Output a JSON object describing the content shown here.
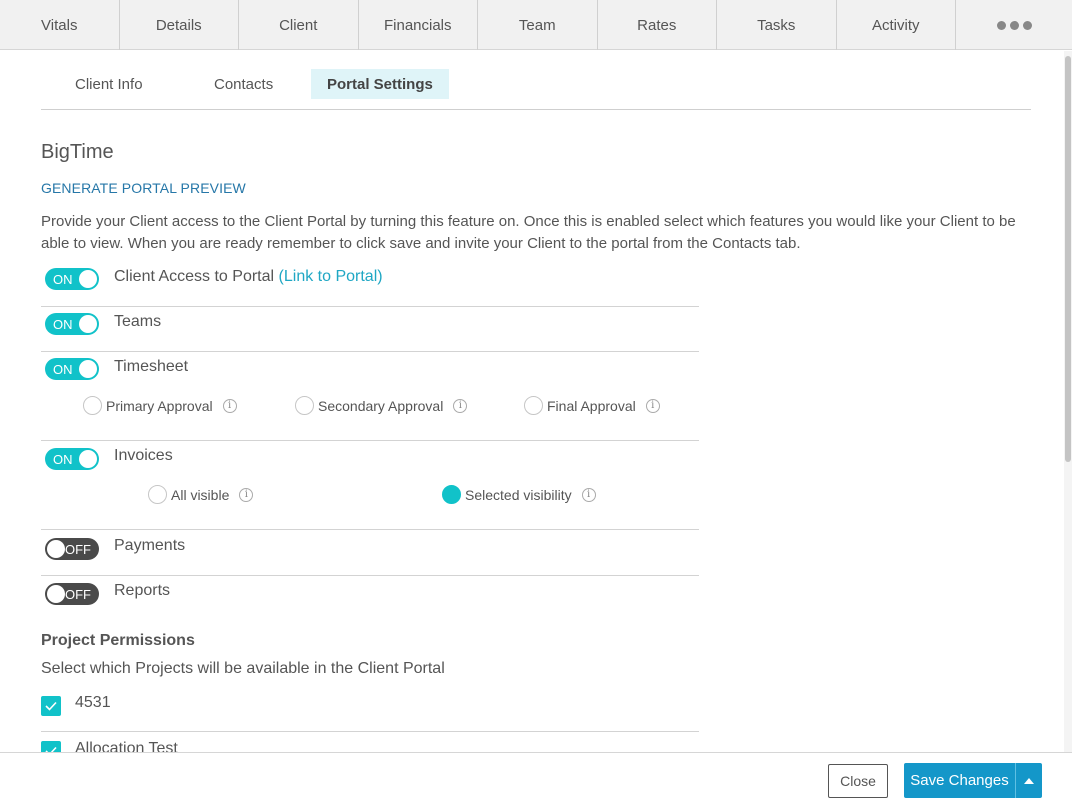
{
  "top_tabs": [
    "Vitals",
    "Details",
    "Client",
    "Financials",
    "Team",
    "Rates",
    "Tasks",
    "Activity"
  ],
  "top_more_icon": "more-horizontal-icon",
  "sub_tabs": [
    "Client Info",
    "Contacts",
    "Portal Settings"
  ],
  "active_sub_tab": "Portal Settings",
  "brand": "BigTime",
  "preview_link": "GENERATE PORTAL PREVIEW",
  "description": "Provide your Client access to the Client Portal by turning this feature on. Once this is enabled select which features you would like your Client to be able to view. When you are ready remember to click save and invite your Client to the portal from the Contacts tab.",
  "features": {
    "client_access": {
      "toggle": "ON",
      "label": "Client Access to Portal",
      "link": "(Link to Portal)"
    },
    "teams": {
      "toggle": "ON",
      "label": "Teams"
    },
    "timesheet": {
      "toggle": "ON",
      "label": "Timesheet",
      "options": [
        "Primary Approval",
        "Secondary Approval",
        "Final Approval"
      ]
    },
    "invoices": {
      "toggle": "ON",
      "label": "Invoices",
      "options": [
        "All visible",
        "Selected visibility"
      ],
      "selected": "Selected visibility"
    },
    "payments": {
      "toggle": "OFF",
      "label": "Payments"
    },
    "reports": {
      "toggle": "OFF",
      "label": "Reports"
    }
  },
  "info_glyph": "i",
  "project_permissions": {
    "title": "Project Permissions",
    "description": "Select which Projects will be available in the Client Portal",
    "projects": [
      {
        "name": "4531",
        "checked": true
      },
      {
        "name": "Allocation Test",
        "checked": true
      }
    ]
  },
  "footer": {
    "close_label": "Close",
    "save_label": "Save Changes"
  },
  "colors": {
    "accent": "#11c2c9",
    "link": "#2677a8",
    "primary_button": "#1497c9",
    "toggle_off": "#4a4a4a"
  }
}
